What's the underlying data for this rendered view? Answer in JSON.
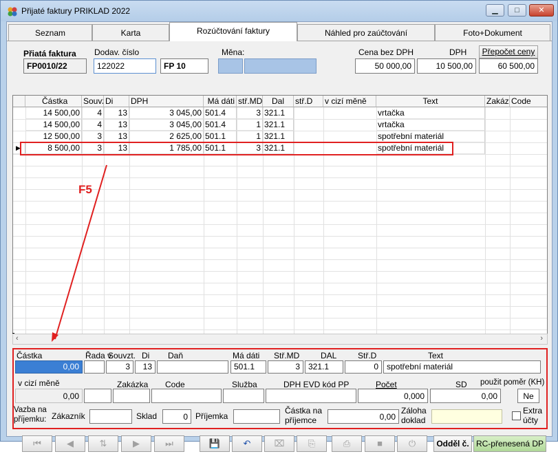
{
  "window": {
    "title": "Přijaté faktury PRIKLAD  2022",
    "min_label": "▁",
    "max_label": "□",
    "close_label": "✕"
  },
  "tabs": [
    "Seznam",
    "Karta",
    "Rozúčtování faktury",
    "Náhled pro zaúčtování",
    "Foto+Dokument"
  ],
  "header": {
    "invoice_label": "Přiatá faktura",
    "invoice_value": "FP0010/22",
    "supplier_no_label": "Dodav.  číslo",
    "supplier_no_value": "122022",
    "fp_value": "FP   10",
    "currency_label": "Měna:",
    "price_excl_vat_label": "Cena bez DPH",
    "price_excl_vat_value": "50 000,00",
    "vat_label": "DPH",
    "vat_value": "10 500,00",
    "recalc_button": "Přepočet ceny",
    "total_value": "60 500,00"
  },
  "grid": {
    "columns": [
      "Částka",
      "Souvz",
      "Di",
      "DPH",
      "Má dáti",
      "stř.MD",
      "Dal",
      "stř.D",
      "v cizí měně",
      "Text",
      "Zakázk",
      "Code"
    ],
    "rows": [
      {
        "castka": "14 500,00",
        "souvz": "4",
        "di": "13",
        "dph": "3 045,00",
        "ma_dati": "501.4",
        "str_md": "3",
        "dal": "321.1",
        "text": "vrtačka"
      },
      {
        "castka": "14 500,00",
        "souvz": "4",
        "di": "13",
        "dph": "3 045,00",
        "ma_dati": "501.4",
        "str_md": "1",
        "dal": "321.1",
        "text": "vrtačka"
      },
      {
        "castka": "12 500,00",
        "souvz": "3",
        "di": "13",
        "dph": "2 625,00",
        "ma_dati": "501.1",
        "str_md": "1",
        "dal": "321.1",
        "text": "spotřební materiál"
      },
      {
        "castka": "8 500,00",
        "souvz": "3",
        "di": "13",
        "dph": "1 785,00",
        "ma_dati": "501.1",
        "str_md": "3",
        "dal": "321.1",
        "text": "spotřební materiál"
      }
    ]
  },
  "annotation": {
    "label": "F5",
    "color": "#e02020"
  },
  "detail": {
    "castka_label": "Částka",
    "castka_value": "0,00",
    "rada_label": "Řada v.",
    "souvzt_label": "Souvzt.",
    "souvzt_value": "3",
    "di_label": "Di",
    "di_value": "13",
    "dan_label": "Daň",
    "ma_dati_label": "Má dáti",
    "ma_dati_value": "501.1",
    "str_md_label": "Stř.MD",
    "str_md_value": "3",
    "dal_label": "DAL",
    "dal_value": "321.1",
    "str_d_label": "Stř.D",
    "str_d_value": "0",
    "text_label": "Text",
    "text_value": "spotřební materiál",
    "foreign_label": "v cizí měně",
    "foreign_value": "0,00",
    "zakazka_label": "Zakázka",
    "code_label": "Code",
    "sluzba_label": "Služba",
    "dph_evd_label": "DPH EVD kód PP",
    "pocet_label": "Počet",
    "pocet_value": "0,000",
    "sd_label": "SD",
    "sd_value": "0,00",
    "ratio_label": "použit poměr (KH)",
    "ratio_value": "Ne",
    "vazba_label1": "Vazba na",
    "vazba_label2": "příjemku:",
    "zakaznik_label": "Zákazník",
    "sklad_label": "Sklad",
    "sklad_value": "0",
    "prijemka_label": "Příjemka",
    "castka_prijemce_label1": "Částka na",
    "castka_prijemce_label2": "příjemce",
    "castka_prijemce_value": "0,00",
    "zaloha_label1": "Záloha",
    "zaloha_label2": "doklad",
    "extra_label1": "Extra",
    "extra_label2": "účty"
  },
  "toolbar": {
    "odd_button": "Odděl č.",
    "rc_button": "RC-přenesená DP"
  }
}
